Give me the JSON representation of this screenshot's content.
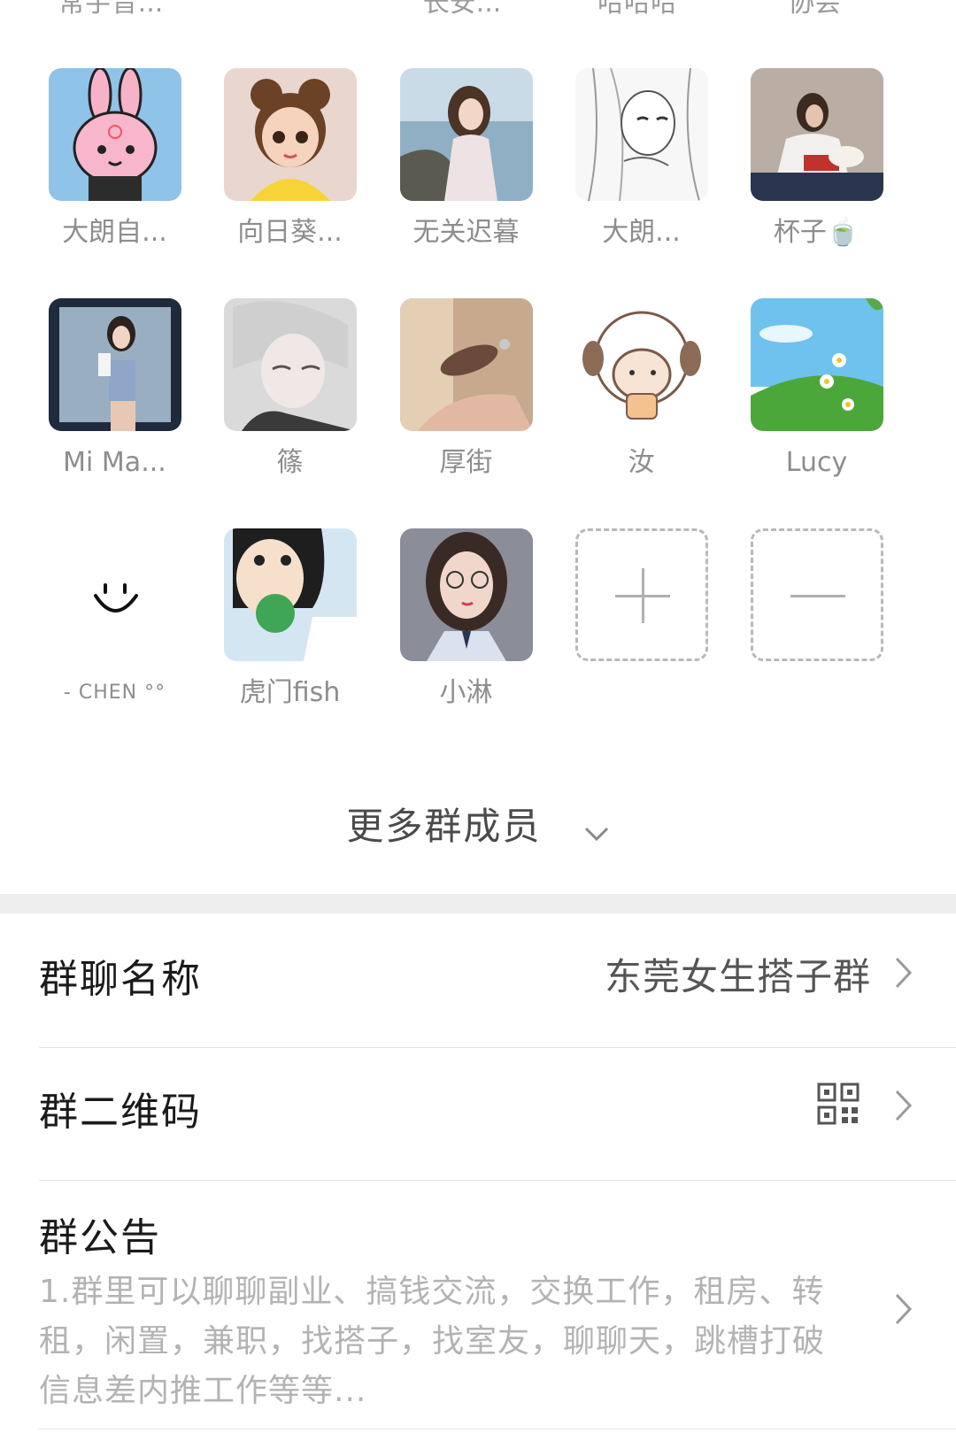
{
  "partial_row": [
    "常宇音...",
    "长安...",
    "哈哈哈",
    "协会"
  ],
  "members": [
    {
      "name": "大朗自...",
      "avatar": "pink-bunny-avatar"
    },
    {
      "name": "向日葵...",
      "avatar": "cartoon-girl-avatar"
    },
    {
      "name": "无关迟暮",
      "avatar": "seaside-photo-avatar"
    },
    {
      "name": "大朗...",
      "avatar": "manga-girl-avatar"
    },
    {
      "name": "杯子🍵",
      "avatar": "girl-with-cat-avatar"
    },
    {
      "name": "Mi Ma...",
      "avatar": "mirror-selfie-avatar"
    },
    {
      "name": "篠",
      "avatar": "anime-boy-avatar"
    },
    {
      "name": "厚街",
      "avatar": "hand-object-avatar"
    },
    {
      "name": "汝",
      "avatar": "sheep-cartoon-avatar"
    },
    {
      "name": "Lucy",
      "avatar": "daisy-field-avatar"
    },
    {
      "name": "- CHEN °°",
      "avatar": "smiley-face-avatar"
    },
    {
      "name": "虎门fish",
      "avatar": "anime-girl-apple-avatar"
    },
    {
      "name": "小淋",
      "avatar": "glasses-girl-avatar"
    }
  ],
  "more_members_label": "更多群成员",
  "group_name": {
    "label": "群聊名称",
    "value": "东莞女生搭子群"
  },
  "group_qr": {
    "label": "群二维码"
  },
  "announcement": {
    "label": "群公告",
    "lines": [
      "1.群里可以聊聊副业、搞钱交流，交换工作，租房、转",
      "租，闲置，兼职，找搭子，找室友，聊聊天，跳槽打破",
      "信息差内推工作等等..."
    ]
  }
}
